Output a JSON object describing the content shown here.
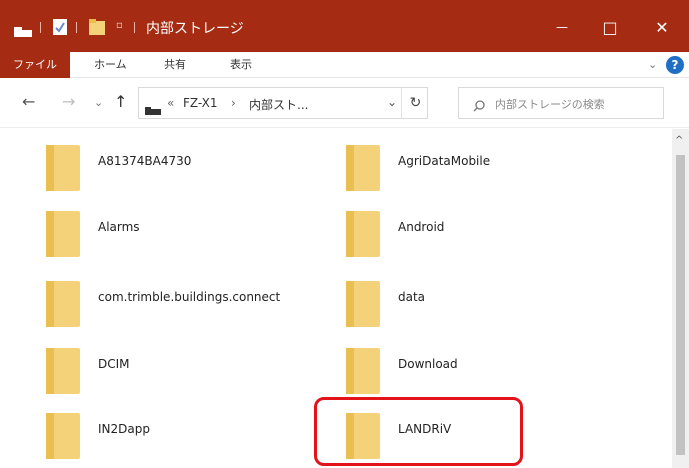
{
  "window": {
    "title": "内部ストレージ",
    "minimize_glyph": "—",
    "maximize_glyph": "□",
    "close_glyph": "✕"
  },
  "ribbon": {
    "tabs": [
      "ファイル",
      "ホーム",
      "共有",
      "表示"
    ],
    "help_glyph": "?"
  },
  "address": {
    "back_glyph": "←",
    "forward_glyph": "→",
    "recent_glyph": "⌄",
    "up_glyph": "↑",
    "overflow": "«",
    "crumbs": [
      "FZ-X1",
      "内部スト..."
    ],
    "separator": "›",
    "dropdown_glyph": "⌄",
    "refresh_glyph": "↻"
  },
  "search": {
    "placeholder": "内部ストレージの検索"
  },
  "files": [
    "A81374BA4730",
    "AgriDataMobile",
    "Alarms",
    "Android",
    "com.trimble.buildings.connect",
    "data",
    "DCIM",
    "Download",
    "IN2Dapp",
    "LANDRiV"
  ],
  "colors": {
    "title_bar": "#a52c12",
    "folder": "#f3d27a",
    "highlight": "#e4131a"
  }
}
